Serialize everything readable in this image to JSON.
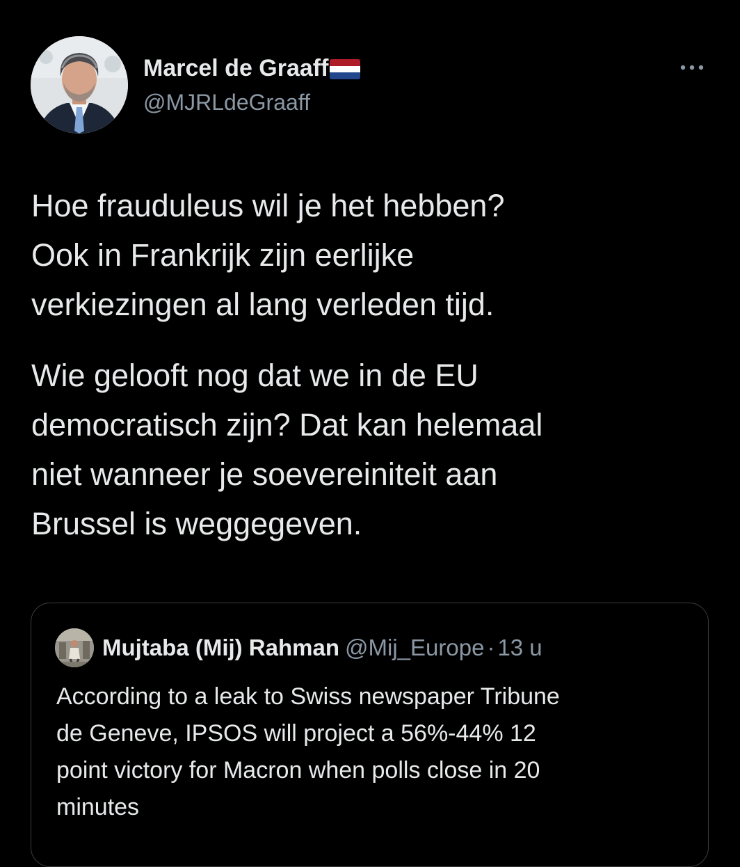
{
  "tweet": {
    "author": {
      "display_name": "Marcel de Graaff",
      "handle": "@MJRLdeGraaff",
      "avatar": "profile-photo",
      "flag": "netherlands-flag-emoji"
    },
    "more_icon": "more-horizontal-icon",
    "paragraphs": [
      "Hoe frauduleus wil je het hebben?\nOok in Frankrijk zijn eerlijke\nverkiezingen al lang verleden tijd.",
      "Wie gelooft nog dat we in de EU\ndemocratisch zijn? Dat kan helemaal\nniet wanneer je soevereiniteit aan\nBrussel is weggegeven."
    ],
    "quoted": {
      "display_name": "Mujtaba (Mij) Rahman",
      "handle": "@Mij_Europe",
      "separator": "·",
      "time": "13 u",
      "text": "According to a leak to Swiss newspaper Tribune\nde Geneve, IPSOS will project a 56%-44% 12\npoint victory for Macron when polls close in 20\nminutes"
    }
  },
  "colors": {
    "background": "#000000",
    "primary_text": "#e7e9ea",
    "secondary_text": "#8b98a5",
    "border": "#3a3d40",
    "flag_red": "#ae1c28",
    "flag_white": "#ffffff",
    "flag_blue": "#21468b"
  }
}
